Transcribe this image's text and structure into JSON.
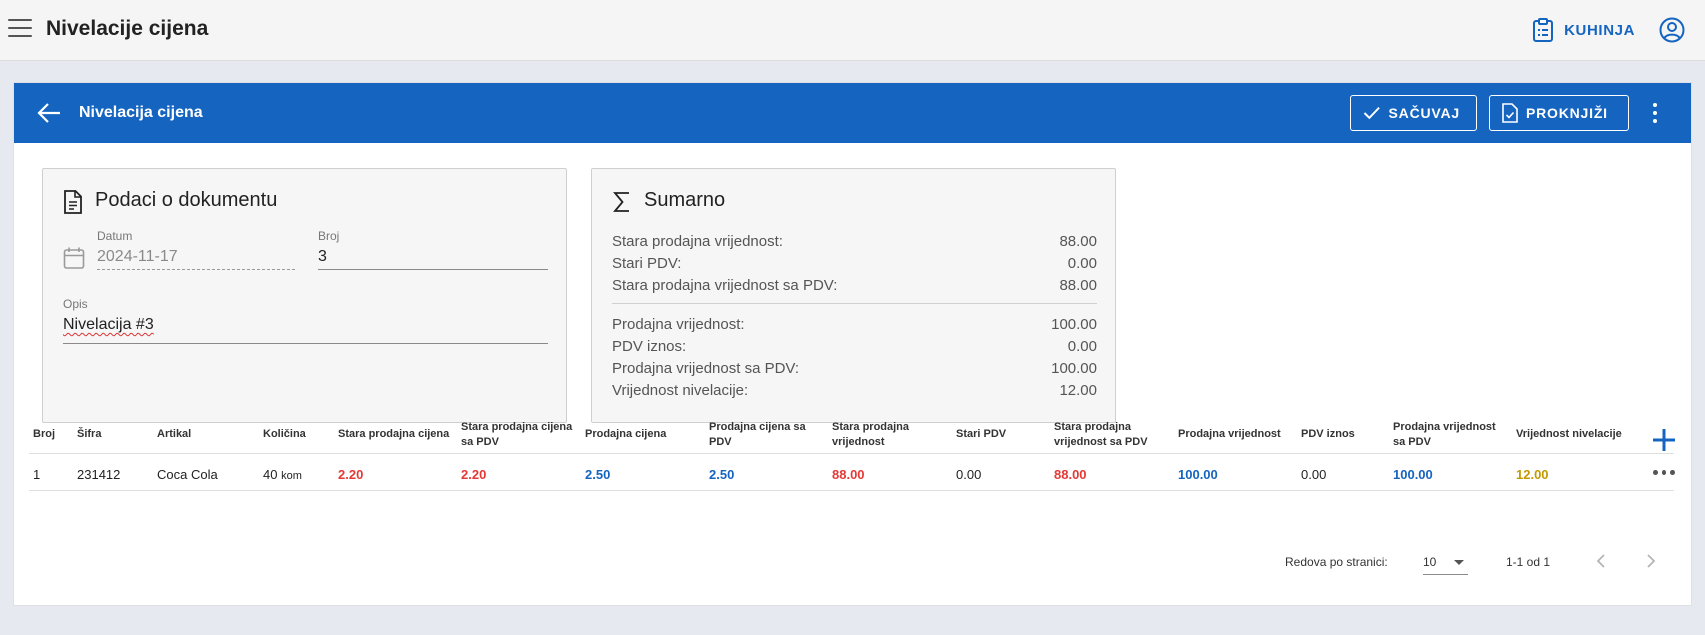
{
  "app": {
    "title": "Nivelacije cijena",
    "kitchen_label": "KUHINJA"
  },
  "card": {
    "title": "Nivelacija cijena",
    "save_label": "SAČUVAJ",
    "post_label": "PROKNJIŽI"
  },
  "doc": {
    "title": "Podaci o dokumentu",
    "date_label": "Datum",
    "date_value": "2024-11-17",
    "number_label": "Broj",
    "number_value": "3",
    "desc_label": "Opis",
    "desc_value": "Nivelacija #3"
  },
  "summary": {
    "title": "Sumarno",
    "rows": [
      {
        "label": "Stara prodajna vrijednost:",
        "value": "88.00"
      },
      {
        "label": "Stari PDV:",
        "value": "0.00"
      },
      {
        "label": "Stara prodajna vrijednost sa PDV:",
        "value": "88.00"
      },
      {
        "label": "Prodajna vrijednost:",
        "value": "100.00"
      },
      {
        "label": "PDV iznos:",
        "value": "0.00"
      },
      {
        "label": "Prodajna vrijednost sa PDV:",
        "value": "100.00"
      },
      {
        "label": "Vrijednost nivelacije:",
        "value": "12.00"
      }
    ]
  },
  "table": {
    "headers": {
      "broj": "Broj",
      "sifra": "Šifra",
      "artikal": "Artikal",
      "kolicina": "Količina",
      "stara_cijena": "Stara prodajna cijena",
      "stara_cijena_pdv_1": "Stara prodajna cijena",
      "stara_cijena_pdv_2": "sa PDV",
      "cijena": "Prodajna cijena",
      "cijena_pdv_1": "Prodajna cijena sa",
      "cijena_pdv_2": "PDV",
      "stara_vrijednost_1": "Stara prodajna",
      "stara_vrijednost_2": "vrijednost",
      "stari_pdv": "Stari PDV",
      "stara_vrijednost_pdv_1": "Stara prodajna",
      "stara_vrijednost_pdv_2": "vrijednost sa PDV",
      "vrijednost": "Prodajna vrijednost",
      "pdv_iznos": "PDV iznos",
      "vrijednost_pdv_1": "Prodajna vrijednost",
      "vrijednost_pdv_2": "sa PDV",
      "nivelacija": "Vrijednost nivelacije"
    },
    "rows": [
      {
        "broj": "1",
        "sifra": "231412",
        "artikal": "Coca Cola",
        "kolicina": "40",
        "unit": "kom",
        "stara_cijena": "2.20",
        "stara_cijena_pdv": "2.20",
        "cijena": "2.50",
        "cijena_pdv": "2.50",
        "stara_vrijednost": "88.00",
        "stari_pdv": "0.00",
        "stara_vrijednost_pdv": "88.00",
        "vrijednost": "100.00",
        "pdv_iznos": "0.00",
        "vrijednost_pdv": "100.00",
        "nivelacija": "12.00"
      }
    ]
  },
  "pagination": {
    "rows_per_page_label": "Redova po stranici:",
    "rows_per_page_value": "10",
    "range": "1-1 od 1"
  },
  "colors": {
    "primary": "#1565c0",
    "old_value": "#e53935",
    "new_value": "#1565c0",
    "difference": "#c29a00"
  }
}
